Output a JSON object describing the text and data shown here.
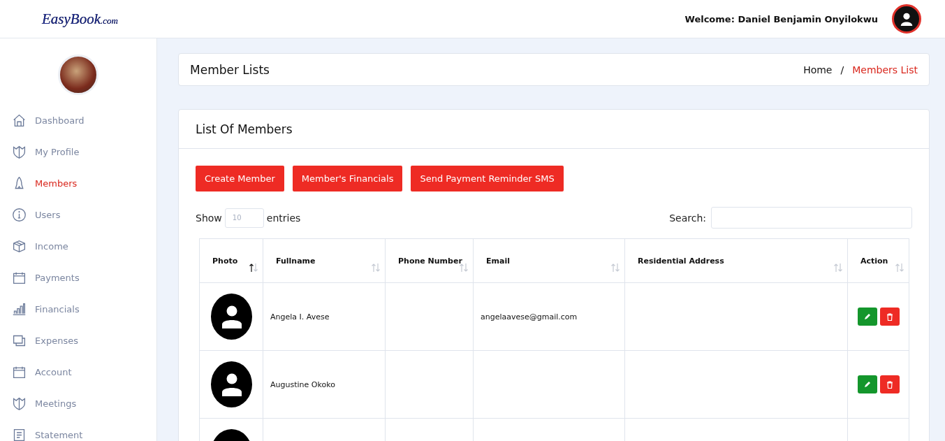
{
  "header": {
    "logo": {
      "brand": "EasyBook",
      "suffix": ".com"
    },
    "welcome": "Welcome: Daniel Benjamin Onyilokwu"
  },
  "sidebar": {
    "items": [
      {
        "label": "Dashboard",
        "selected": false
      },
      {
        "label": "My Profile",
        "selected": false
      },
      {
        "label": "Members",
        "selected": true
      },
      {
        "label": "Users",
        "selected": false
      },
      {
        "label": "Income",
        "selected": false
      },
      {
        "label": "Payments",
        "selected": false
      },
      {
        "label": "Financials",
        "selected": false
      },
      {
        "label": "Expenses",
        "selected": false
      },
      {
        "label": "Account",
        "selected": false
      },
      {
        "label": "Meetings",
        "selected": false
      },
      {
        "label": "Statement",
        "selected": false
      }
    ]
  },
  "page_header": {
    "title": "Member Lists",
    "breadcrumb": [
      {
        "label": "Home",
        "selected": false
      },
      {
        "label": "Members List",
        "selected": true
      }
    ],
    "separator": "/"
  },
  "card": {
    "title": "List Of Members",
    "buttons": [
      "Create Member",
      "Member's Financials",
      "Send Payment Reminder SMS"
    ],
    "length": {
      "label_before": "Show",
      "placeholder": "10",
      "label_after": "entries"
    },
    "search": {
      "label": "Search:"
    },
    "table": {
      "columns": [
        {
          "label": "Photo",
          "sorted": true
        },
        {
          "label": "Fullname",
          "sorted": false
        },
        {
          "label": "Phone Number",
          "sorted": false
        },
        {
          "label": "Email",
          "sorted": false
        },
        {
          "label": "Residential Address",
          "sorted": false
        },
        {
          "label": "Action",
          "sorted": false
        }
      ],
      "rows": [
        {
          "kind": "member",
          "fullname": "Angela I. Avese",
          "email": "angelaavese@gmail.com"
        },
        {
          "kind": "member",
          "fullname": "Augustine Okoko"
        },
        {
          "kind": "member"
        }
      ]
    }
  }
}
